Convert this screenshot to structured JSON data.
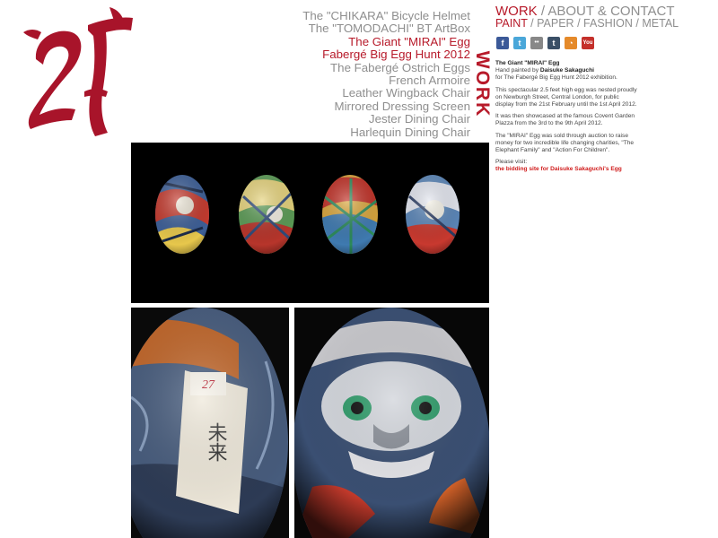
{
  "logo": {
    "alt": "27"
  },
  "projects": [
    {
      "label": "The \"CHIKARA\" Bicycle Helmet",
      "active": false
    },
    {
      "label": "The \"TOMODACHI\" BT ArtBox",
      "active": false
    },
    {
      "label": "The Giant \"MIRAI\" Egg",
      "active": true
    },
    {
      "label": "Fabergé Big Egg Hunt 2012",
      "active": true
    },
    {
      "label": "The Fabergé Ostrich Eggs",
      "active": false
    },
    {
      "label": "French Armoire",
      "active": false
    },
    {
      "label": "Leather Wingback Chair",
      "active": false
    },
    {
      "label": "Mirrored Dressing Screen",
      "active": false
    },
    {
      "label": "Jester Dining Chair",
      "active": false
    },
    {
      "label": "Harlequin Dining Chair",
      "active": false
    }
  ],
  "section_label": "WORK",
  "topnav": {
    "work": "WORK",
    "sep": "/",
    "about": "ABOUT & CONTACT"
  },
  "subnav": {
    "paint": "PAINT",
    "paper": "PAPER",
    "fashion": "FASHION",
    "metal": "METAL",
    "sep": "/"
  },
  "social": [
    {
      "name": "facebook-icon",
      "glyph": "f"
    },
    {
      "name": "twitter-icon",
      "glyph": "t"
    },
    {
      "name": "flickr-icon",
      "glyph": "••"
    },
    {
      "name": "tumblr-icon",
      "glyph": "t"
    },
    {
      "name": "rss-icon",
      "glyph": "◔"
    },
    {
      "name": "youtube-icon",
      "glyph": "You"
    }
  ],
  "info": {
    "title": "The Giant \"MIRAI\" Egg",
    "byline_prefix": "Hand painted by ",
    "artist": "Daisuke Sakaguchi",
    "byline_suffix": "for The Fabergé Big Egg Hunt 2012 exhibition.",
    "p1": "This spectacular 2.5 feet high egg was nested proudly on Newburgh Street, Central London, for public display from the 21st February until the 1st April 2012.",
    "p2": "It was then showcased at the famous Covent Garden Plazza from the 3rd to the 9th April 2012.",
    "p3": "The \"MIRAI\" Egg was sold through auction to raise money for two incredible life changing charities, \"The Elephant Family\" and \"Action For Children\".",
    "visit": "Please visit:",
    "link": "the bidding site for Daisuke Sakaguchi's Egg"
  },
  "photos": {
    "bl_stamp": "27",
    "bl_calligraphy": "未来"
  },
  "colors": {
    "accent": "#b71a2a",
    "muted": "#8e8e8e",
    "link": "#d01c1c"
  }
}
